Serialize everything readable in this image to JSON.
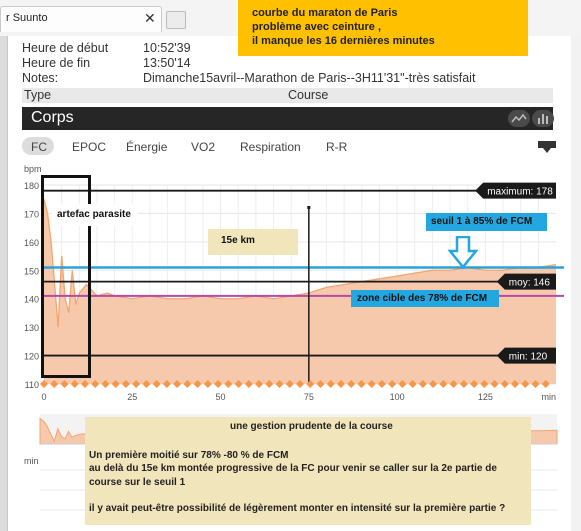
{
  "browser": {
    "tab_title": "r Suunto",
    "close": "✕"
  },
  "info": {
    "start_label": "Heure de début",
    "start_value": "10:52'39",
    "end_label": "Heure de fin",
    "end_value": "13:50'14",
    "notes_label": "Notes:",
    "notes_value": "Dimanche15avril--Marathon de Paris--3H11'31\"-très satisfait",
    "type_label": "Type",
    "type_value": "Course"
  },
  "corps": {
    "title": "Corps"
  },
  "tabs": [
    "FC",
    "EPOC",
    "Énergie",
    "VO2",
    "Respiration",
    "R-R"
  ],
  "annotation_top": {
    "line1": "courbe du maraton de Paris",
    "line2": "problème avec ceinture ,",
    "line3": "il manque les 16 dernières minutes"
  },
  "annotations_chart": {
    "artefact": "artefac  parasite",
    "km15": "15e km",
    "seuil": "seuil 1 à 85% de FCM",
    "zone": "zone cible des 78% de FCM"
  },
  "annotation_bottom": {
    "title": "une gestion prudente de la course",
    "line1": "Un première moitié sur 78% -80 % de FCM",
    "line2": "au delà du  15e  km  montée progressive de la FC pour venir se caller sur la 2e partie de",
    "line3": "course sur le seuil 1",
    "line4": "il y avait peut-être possibilité de légèrement monter en intensité sur la première partie ?"
  },
  "colors": {
    "fill": "#f6c9ad",
    "line": "#f5a46d",
    "marker": "#f79646",
    "seuil": "#2aa3da",
    "zone": "#b24aa6",
    "dark": "#1a1a1a",
    "tag_blue": "#23a7e0"
  },
  "chart_data": {
    "type": "area",
    "ylabel": "bpm",
    "xlabel": "min",
    "xlim": [
      0,
      145
    ],
    "ylim": [
      110,
      180
    ],
    "xticks": [
      0,
      25,
      50,
      75,
      100,
      125
    ],
    "yticks": [
      110,
      120,
      130,
      140,
      150,
      160,
      170,
      180
    ],
    "markers": [
      {
        "label": "maximum: 178",
        "value": 178
      },
      {
        "label": "moy: 146",
        "value": 146
      },
      {
        "label": "min: 120",
        "value": 120
      }
    ],
    "reference_lines": [
      {
        "value": 151,
        "color": "#2aa3da"
      },
      {
        "value": 141,
        "color": "#b24aa6"
      }
    ],
    "vertical_marker": 75,
    "series": [
      {
        "x": [
          0,
          1,
          2,
          3,
          4,
          5,
          6,
          7,
          8,
          9,
          10,
          12,
          15,
          18,
          20,
          25,
          30,
          35,
          40,
          45,
          50,
          55,
          60,
          65,
          70,
          75,
          80,
          85,
          90,
          95,
          100,
          105,
          110,
          115,
          120,
          125,
          130,
          135,
          140,
          145
        ],
        "values": [
          175,
          170,
          160,
          145,
          130,
          155,
          140,
          135,
          150,
          138,
          142,
          145,
          141,
          142,
          141,
          140,
          141,
          140,
          140,
          141,
          140,
          140,
          141,
          140,
          141,
          142,
          144,
          145,
          146,
          147,
          148,
          149,
          150,
          150,
          151,
          150,
          150,
          151,
          151,
          152
        ]
      }
    ],
    "grid": true,
    "second_chart_ylabel": "min"
  }
}
